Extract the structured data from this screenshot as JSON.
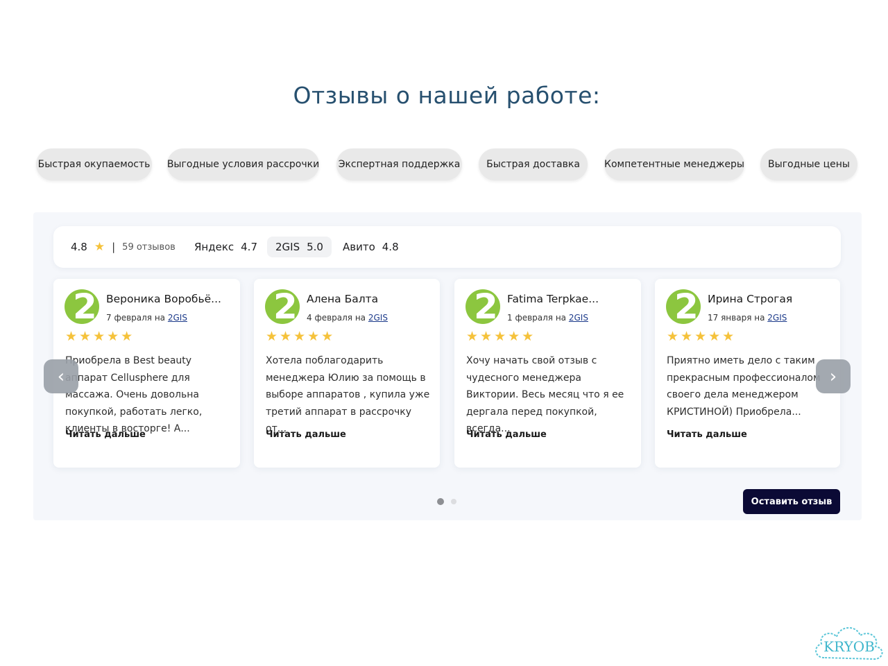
{
  "heading": "Отзывы о нашей работе:",
  "chips": [
    "Быстрая окупаемость",
    "Выгодные условия рассрочки",
    "Экспертная поддержка",
    "Быстрая доставка",
    "Компетентные менеджеры",
    "Выгодные цены"
  ],
  "ratings": {
    "overall": "4.8",
    "separator": "|",
    "count": "59 отзывов",
    "sources": [
      {
        "name": "Яндекс",
        "value": "4.7"
      },
      {
        "name": "2GIS",
        "value": "5.0"
      },
      {
        "name": "Авито",
        "value": "4.8"
      }
    ]
  },
  "reviews": [
    {
      "name": "Вероника Воробьё...",
      "date": "7 февраля на",
      "source": "2GIS",
      "stars": "★★★★★",
      "text": "Приобрела в Best beauty аппарат Cellusphere для массажа. Очень довольна покупкой, работать легко, клиенты в восторге! А...",
      "more": "Читать дальше"
    },
    {
      "name": "Алена Балта",
      "date": "4 февраля на",
      "source": "2GIS",
      "stars": "★★★★★",
      "text": "Хотела поблагодарить менеджера Юлию за помощь в выборе аппаратов , купила уже третий аппарат в рассрочку от...",
      "more": "Читать дальше"
    },
    {
      "name": "Fatima Terpkae...",
      "date": "1 февраля на",
      "source": "2GIS",
      "stars": "★★★★★",
      "text": "Хочу начать свой отзыв с чудесного менеджера Виктории. Весь месяц что я ее дергала перед покупкой, всегда...",
      "more": "Читать дальше"
    },
    {
      "name": "Ирина Строгая",
      "date": "17 января на",
      "source": "2GIS",
      "stars": "★★★★★",
      "text": "Приятно иметь дело с таким прекрасным профессионалом своего дела менеджером КРИСТИНОЙ) Приобрела...",
      "more": "Читать дальше"
    }
  ],
  "avatar_digit": "2",
  "nav": {
    "prev": "‹",
    "next": "›"
  },
  "cta_label": "Оставить отзыв",
  "watermark": "KRYOB",
  "colors": {
    "accent": "#27506f",
    "star": "#f5c23b",
    "avatar": "#8cc63f",
    "cta": "#0b0a35"
  }
}
